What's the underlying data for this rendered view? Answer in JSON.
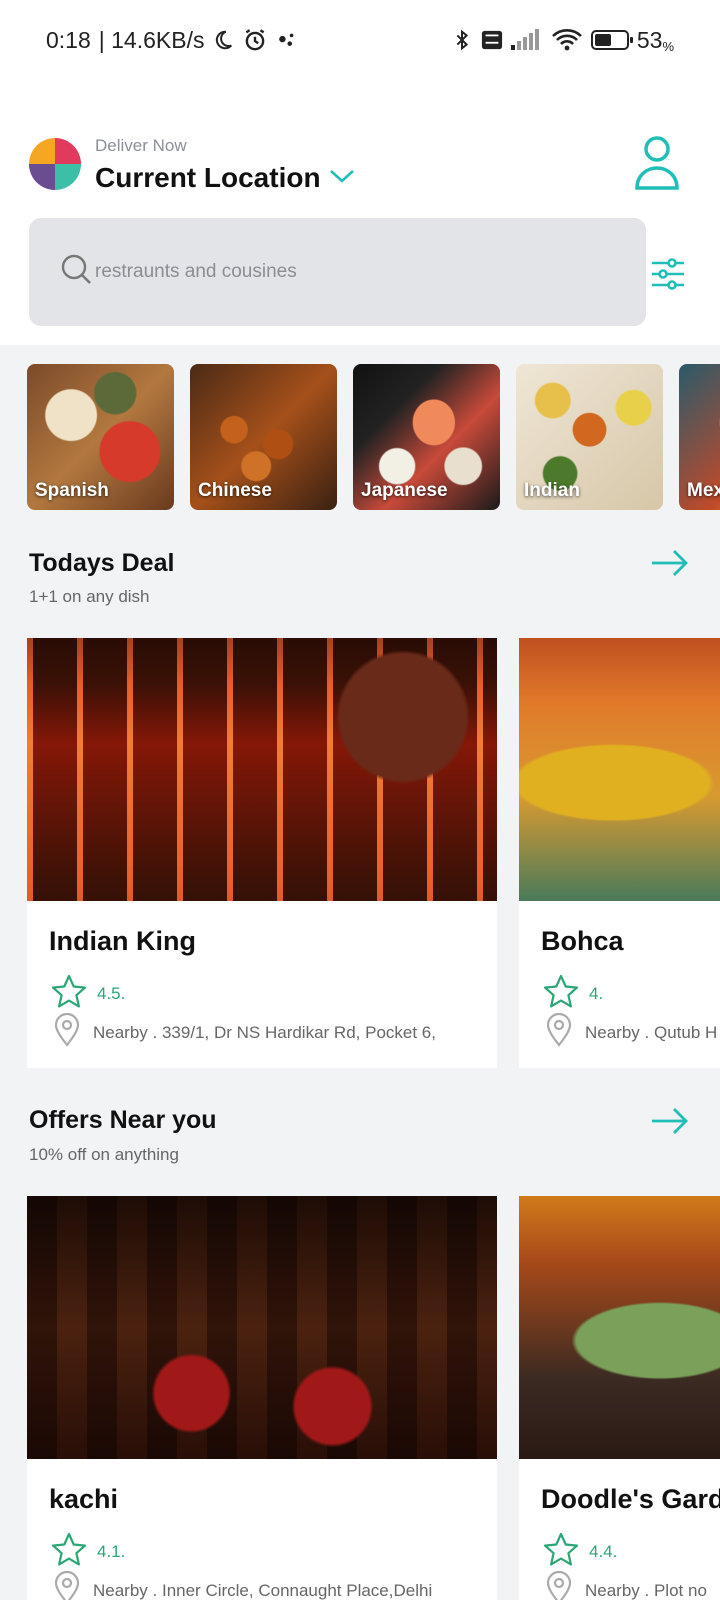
{
  "status_bar": {
    "time": "0:18",
    "speed": "| 14.6KB/s",
    "battery_level": "53",
    "battery_unit": "%",
    "battery_fraction": 0.53,
    "icons": [
      "moon-icon",
      "alarm-icon",
      "dots-icon",
      "bluetooth-icon",
      "volte-icon",
      "signal-icon",
      "wifi-icon",
      "battery-icon"
    ]
  },
  "header": {
    "deliver_label": "Deliver Now",
    "location": "Current Location",
    "accent_color": "#1fbfb8"
  },
  "search": {
    "placeholder": "restraunts and cousines",
    "value": ""
  },
  "cuisines": [
    {
      "label": "Spanish"
    },
    {
      "label": "Chinese"
    },
    {
      "label": "Japanese"
    },
    {
      "label": "Indian"
    },
    {
      "label": "Mex"
    }
  ],
  "todays_deal": {
    "title": "Todays Deal",
    "subtitle": "1+1 on any dish",
    "cards": [
      {
        "name": "Indian King",
        "rating": "4.5.",
        "address": "Nearby . 339/1, Dr NS Hardikar Rd, Pocket 6,"
      },
      {
        "name": "Bohca",
        "rating": "4.",
        "address": "Nearby . Qutub H"
      }
    ]
  },
  "offers_near_you": {
    "title": "Offers Near you",
    "subtitle": "10% off on anything",
    "cards": [
      {
        "name": "kachi",
        "rating": "4.1.",
        "address": "Nearby . Inner Circle, Connaught Place,Delhi"
      },
      {
        "name": "Doodle's Garde",
        "rating": "4.4.",
        "address": "Nearby . Plot no"
      }
    ]
  },
  "colors": {
    "accent": "#1fbfb8",
    "rating_green": "#2aa775",
    "background": "#f2f3f5"
  }
}
